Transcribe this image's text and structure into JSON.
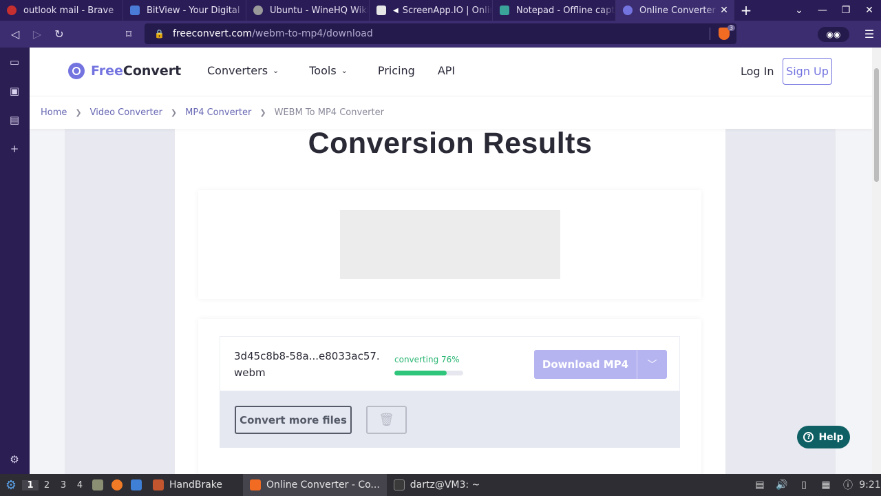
{
  "browser": {
    "tabs": [
      {
        "title": "outlook mail - Brave",
        "color": "#c62f2f"
      },
      {
        "title": "BitView - Your Digital",
        "color": "#4a7bd6"
      },
      {
        "title": "Ubuntu - WineHQ Wiki",
        "color": "#9a9a9a"
      },
      {
        "title": "ScreenApp.IO | Online",
        "color": "#e6e6e6"
      },
      {
        "title": "Notepad - Offline captu",
        "color": "#3aa39a"
      },
      {
        "title": "Online Converter -",
        "color": "#7474e0"
      }
    ],
    "new_tab": "+",
    "url_domain": "freeconvert.com",
    "url_path": "/webm-to-mp4/download",
    "shield_count": "3"
  },
  "site": {
    "logo_free": "Free",
    "logo_convert": "Convert",
    "nav": {
      "converters": "Converters",
      "tools": "Tools",
      "pricing": "Pricing",
      "api": "API"
    },
    "login": "Log In",
    "signup": "Sign Up",
    "breadcrumb": [
      "Home",
      "Video Converter",
      "MP4 Converter",
      "WEBM To MP4 Converter"
    ]
  },
  "main": {
    "title": "Conversion Results",
    "file": {
      "name": "3d45c8b8-58a...e8033ac57.webm",
      "status": "converting 76%",
      "progress": 0.76
    },
    "download_label": "Download MP4",
    "convert_more_label": "Convert more files",
    "help_label": "Help"
  },
  "taskbar": {
    "workspaces": [
      "1",
      "2",
      "3",
      "4"
    ],
    "apps": [
      {
        "label": "HandBrake",
        "color": "#c4562f"
      },
      {
        "label": "Online Converter - Co...",
        "color": "#f26b23"
      },
      {
        "label": "dartz@VM3: ~",
        "color": "#3a3a3a"
      }
    ],
    "clock": "9:21"
  }
}
